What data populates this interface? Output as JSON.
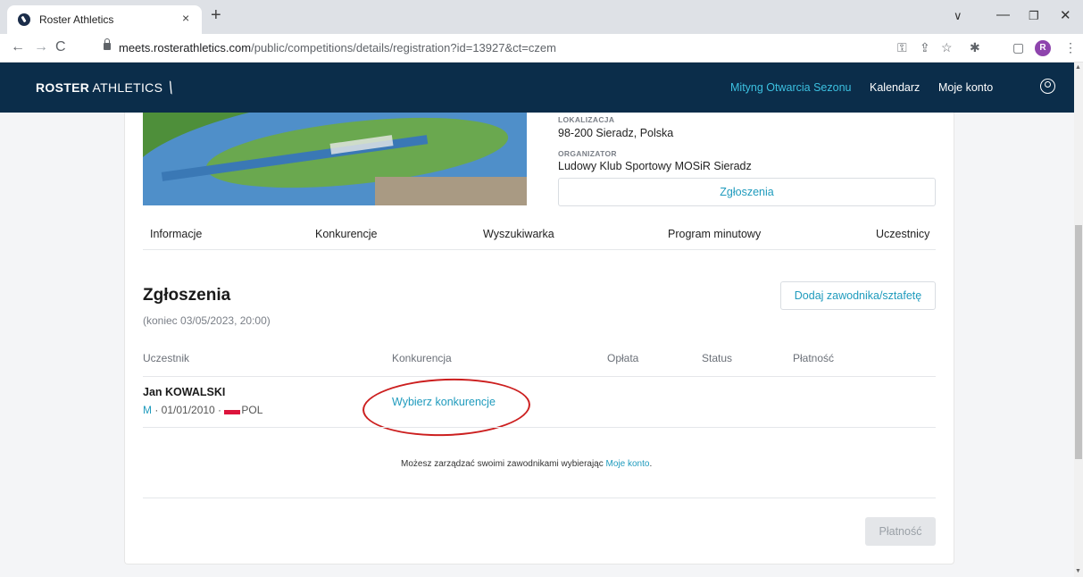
{
  "browser": {
    "tab_title": "Roster Athletics",
    "close_tab_glyph": "×",
    "new_tab_glyph": "+",
    "tab_list_glyph": "∨",
    "minimize_glyph": "—",
    "maximize_glyph": "❐",
    "close_window_glyph": "✕",
    "back_glyph": "←",
    "forward_glyph": "→",
    "reload_glyph": "C",
    "url_host": "meets.rosterathletics.com",
    "url_path": "/public/competitions/details/registration?id=13927&ct=czem",
    "key_glyph": "⚿",
    "share_glyph": "⇪",
    "star_glyph": "☆",
    "extensions_glyph": "✱",
    "sidepanel_glyph": "▢",
    "profile_initial": "R",
    "menu_glyph": "⋮"
  },
  "header": {
    "logo_bold": "ROSTER",
    "logo_thin": " ATHLETICS",
    "logo_mark": "⟍",
    "nav": {
      "meet": "Mityng Otwarcia Sezonu",
      "calendar": "Kalendarz",
      "account": "Moje konto"
    }
  },
  "scrollbar": {
    "up_glyph": "▲",
    "down_glyph": "▼"
  },
  "competition": {
    "location_label": "LOKALIZACJA",
    "location_value": "98-200 Sieradz, Polska",
    "organizer_label": "ORGANIZATOR",
    "organizer_value": "Ludowy Klub Sportowy MOSiR Sieradz",
    "entries_button": "Zgłoszenia"
  },
  "tabs": [
    "Informacje",
    "Konkurencje",
    "Wyszukiwarka",
    "Program minutowy",
    "Uczestnicy"
  ],
  "registration": {
    "title": "Zgłoszenia",
    "deadline": "(koniec 03/05/2023, 20:00)",
    "add_button": "Dodaj zawodnika/sztafetę",
    "columns": [
      "Uczestnik",
      "Konkurencja",
      "Opłata",
      "Status",
      "Płatność"
    ],
    "rows": [
      {
        "name": "Jan KOWALSKI",
        "sex": "M",
        "birth_sep": " · 01/01/2010 · ",
        "country": "POL",
        "event_link": "Wybierz konkurencje"
      }
    ],
    "note_text": "Możesz zarządzać swoimi zawodnikami wybierając ",
    "note_link": "Moje konto",
    "note_end": ".",
    "pay_button": "Płatność"
  },
  "colors": {
    "header_bg": "#0b2d4a",
    "accent": "#1f9bbd",
    "active_nav": "#3cc0e0",
    "annotation": "#cc1f1f"
  }
}
